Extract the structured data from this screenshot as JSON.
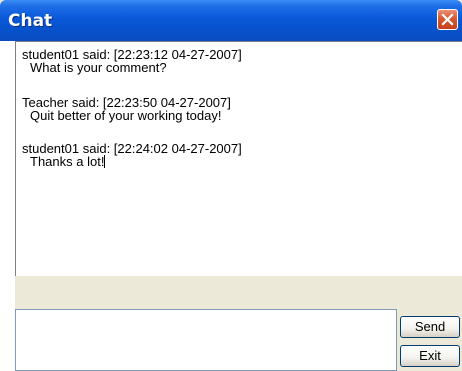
{
  "window": {
    "title": "Chat"
  },
  "messages": [
    {
      "header": "student01 said: [22:23:12 04-27-2007]",
      "text": "What is your comment?"
    },
    {
      "header": "Teacher said: [22:23:50 04-27-2007]",
      "text": "Quit better of your working today!"
    },
    {
      "header": "student01 said: [22:24:02 04-27-2007]",
      "text": "Thanks a lot!"
    }
  ],
  "compose": {
    "value": "",
    "send_label": "Send",
    "exit_label": "Exit"
  }
}
